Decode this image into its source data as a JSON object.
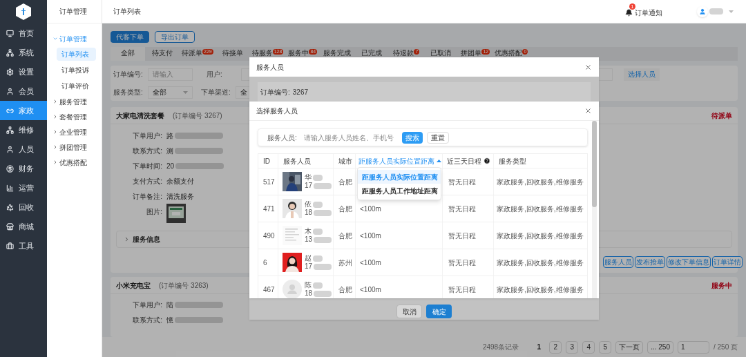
{
  "sidebar": {
    "items": [
      {
        "label": "首页",
        "selected": false
      },
      {
        "label": "系统",
        "selected": false
      },
      {
        "label": "设置",
        "selected": false
      },
      {
        "label": "会员",
        "selected": false
      },
      {
        "label": "家政",
        "selected": true
      },
      {
        "label": "维修",
        "selected": false
      },
      {
        "label": "人员",
        "selected": false
      },
      {
        "label": "财务",
        "selected": false
      },
      {
        "label": "运营",
        "selected": false
      },
      {
        "label": "回收",
        "selected": false
      },
      {
        "label": "商城",
        "selected": false
      },
      {
        "label": "工具",
        "selected": false
      }
    ]
  },
  "submenu": {
    "title": "订单管理",
    "items": [
      {
        "label": "订单管理",
        "expanded": true,
        "children": [
          {
            "label": "订单列表",
            "selected": true
          },
          {
            "label": "订单投诉",
            "selected": false
          },
          {
            "label": "订单评价",
            "selected": false
          }
        ]
      },
      {
        "label": "服务管理",
        "expanded": false
      },
      {
        "label": "套餐管理",
        "expanded": false
      },
      {
        "label": "企业管理",
        "expanded": false
      },
      {
        "label": "拼团管理",
        "expanded": false
      },
      {
        "label": "优惠搭配",
        "expanded": false
      }
    ]
  },
  "header": {
    "breadcrumb": "订单列表",
    "notification": {
      "badge": "1",
      "label": "订单通知"
    },
    "user": {
      "redacted": true
    }
  },
  "toolbar": [
    {
      "label": "代客下单",
      "kind": "primary"
    },
    {
      "label": "导出订单",
      "kind": "outline"
    }
  ],
  "tabs": [
    {
      "label": "全部",
      "selected": true
    },
    {
      "label": "待支付",
      "selected": false
    },
    {
      "label": "待派单",
      "badge": "229",
      "selected": false
    },
    {
      "label": "待接单",
      "selected": false
    },
    {
      "label": "待服务",
      "badge": "128",
      "selected": false
    },
    {
      "label": "服务中",
      "badge": "84",
      "selected": false
    },
    {
      "label": "服务完成",
      "selected": false
    },
    {
      "label": "已完成",
      "selected": false
    },
    {
      "label": "待退款",
      "badge": "7",
      "selected": false
    },
    {
      "label": "已取消",
      "selected": false
    },
    {
      "label": "拼团单",
      "badge": "12",
      "selected": false
    },
    {
      "label": "优惠搭配",
      "badge": "0",
      "selected": false
    }
  ],
  "filters": [
    {
      "kind": "input",
      "label": "订单编号:",
      "placeholder": "请输入"
    },
    {
      "kind": "input",
      "label": "用户:"
    },
    {
      "kind": "select",
      "label": "服务类型:",
      "value": "全部"
    },
    {
      "kind": "select",
      "label": "下单渠道:",
      "value": "全"
    }
  ],
  "filter_action": "选择人员",
  "orders": [
    {
      "title": "大家电清洗套餐",
      "number": "(订单编号 3267)",
      "status": "待派单",
      "fields": [
        {
          "kind": "text",
          "label": "下单用户:",
          "value": "路",
          "redacted": true
        },
        {
          "kind": "text",
          "label": "联系方式:",
          "value": "测",
          "redacted": true
        },
        {
          "kind": "text",
          "label": "下单时间:",
          "value": "20",
          "redacted": true
        },
        {
          "kind": "text",
          "label": "支付方式:",
          "value": "余额支付",
          "redacted": false
        },
        {
          "kind": "text",
          "label": "订单备注:",
          "value": "清洗服务",
          "redacted": false
        },
        {
          "kind": "picture",
          "label": "图片:"
        }
      ],
      "service_info": "服务信息",
      "actions": [
        "服务人员",
        "发布抢单",
        "修改下单信息",
        "订单详情"
      ]
    },
    {
      "title": "小米充电宝",
      "number": "(订单编号 3263)",
      "status": "服务中",
      "fields": [
        {
          "kind": "text",
          "label": "下单用户:",
          "value": "陆",
          "redacted": true
        },
        {
          "kind": "text",
          "label": "联系方式:",
          "value": "憶",
          "redacted": true
        }
      ]
    }
  ],
  "pagination": {
    "total": "2498条记录",
    "pages": [
      {
        "label": "1",
        "selected": true
      },
      {
        "label": "2",
        "selected": false
      },
      {
        "label": "3",
        "selected": false
      },
      {
        "label": "4",
        "selected": false
      },
      {
        "label": "5",
        "selected": false
      }
    ],
    "next": "下一页",
    "last": "... 250",
    "page_input": "1",
    "page_count": "/ 250 页"
  },
  "dialog": {
    "title": "服务人员",
    "order_label": "订单编号:",
    "order_number": "3267",
    "buttons": [
      {
        "label": "取消",
        "kind": "default"
      },
      {
        "label": "确定",
        "kind": "primary"
      }
    ]
  },
  "picker": {
    "title": "选择服务人员",
    "search": {
      "label": "服务人员:",
      "placeholder": "请输入服务人员姓名、手机号",
      "buttons": [
        {
          "label": "搜索",
          "kind": "primary"
        },
        {
          "label": "重置",
          "kind": "default"
        }
      ]
    },
    "columns": [
      {
        "label": "ID"
      },
      {
        "label": "服务人员"
      },
      {
        "label": "城市"
      },
      {
        "label": "距服务人员实际位置距离",
        "sorted": true
      },
      {
        "label": "近三天日程",
        "help": true
      },
      {
        "label": "服务类型"
      }
    ],
    "rows": [
      {
        "id": "517",
        "name": "华",
        "phone": "17",
        "city": "合肥",
        "schedule": "暂无日程",
        "services": "家政服务,回收服务,维修服务"
      },
      {
        "id": "471",
        "name": "依",
        "phone": "18",
        "city": "合肥",
        "distance": "<100m",
        "schedule": "暂无日程",
        "services": "家政服务,回收服务,维修服务"
      },
      {
        "id": "490",
        "name": "木",
        "phone": "13",
        "city": "合肥",
        "distance": "<100m",
        "schedule": "暂无日程",
        "services": "家政服务,回收服务,维修服务"
      },
      {
        "id": "6",
        "name": "赵",
        "phone": "17",
        "city": "苏州",
        "distance": "<100m",
        "schedule": "暂无日程",
        "services": "家政服务,回收服务,维修服务"
      },
      {
        "id": "467",
        "name": "陈",
        "phone": "18",
        "kind": "default",
        "city": "合肥",
        "distance": "<100m",
        "schedule": "暂无日程",
        "services": "家政服务,回收服务,维修服务"
      }
    ],
    "sort_menu": [
      {
        "label": "距服务人员实际位置距离",
        "selected": true
      },
      {
        "label": "距服务人员工作地址距离",
        "selected": false
      }
    ]
  }
}
